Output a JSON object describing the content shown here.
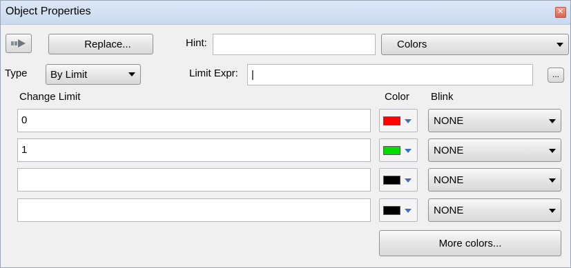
{
  "window": {
    "title": "Object Properties"
  },
  "toolbar": {
    "replace_label": "Replace...",
    "hint_label": "Hint:",
    "hint_value": "",
    "category_selected": "Colors"
  },
  "type_row": {
    "type_label": "Type",
    "type_selected": "By Limit",
    "limit_expr_label": "Limit Expr:",
    "limit_expr_value": "|",
    "browse_label": "..."
  },
  "grid": {
    "headers": {
      "change_limit": "Change Limit",
      "color": "Color",
      "blink": "Blink"
    },
    "rows": [
      {
        "limit": "0",
        "color": "#ff0000",
        "blink": "NONE"
      },
      {
        "limit": "1",
        "color": "#00dd00",
        "blink": "NONE"
      },
      {
        "limit": "",
        "color": "#000000",
        "blink": "NONE"
      },
      {
        "limit": "",
        "color": "#000000",
        "blink": "NONE"
      }
    ]
  },
  "more_colors_label": "More colors..."
}
